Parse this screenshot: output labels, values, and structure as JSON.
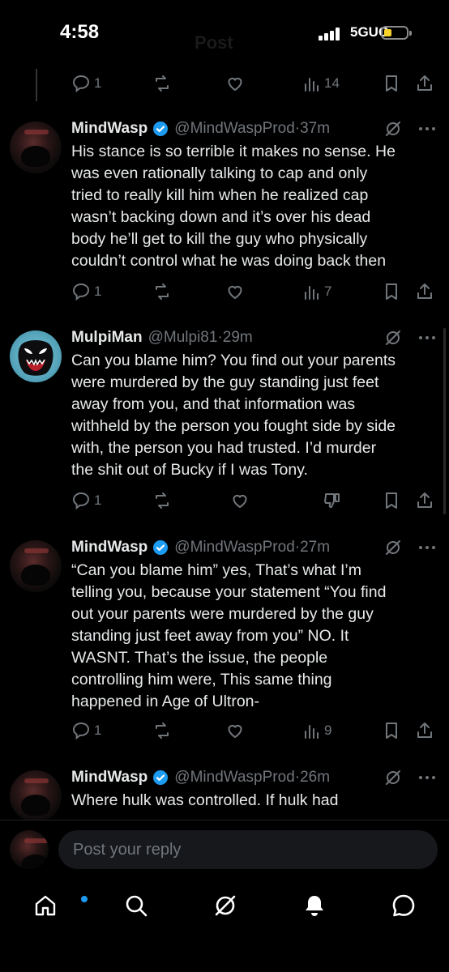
{
  "status_bar": {
    "time": "4:58",
    "network": "5GUC",
    "battery_level": 0.25,
    "header_title": "Post"
  },
  "top_actions": {
    "replies": "1",
    "views": "14"
  },
  "tweets": [
    {
      "name": "MindWasp",
      "verified": true,
      "handle": "@MindWaspProd",
      "time": "·37m",
      "lines": [
        "His stance is so terrible it makes no sense. He",
        "was even rationally talking to cap and only",
        "tried to really kill him when he realized cap",
        "wasn’t backing down and it’s over his dead",
        "body he’ll get to kill the guy who physically",
        "couldn’t control what he was doing back then"
      ],
      "replies": "1",
      "views": "7"
    },
    {
      "name": "MulpiMan",
      "verified": false,
      "handle": "@Mulpi81",
      "time": "·29m",
      "lines": [
        "Can you blame him? You find out your parents",
        "were murdered by the guy standing just feet",
        "away from you, and that information was",
        "withheld by the person you fought side by side",
        "with, the person you had trusted. I’d murder",
        "the shit out of Bucky if I was Tony."
      ],
      "replies": "1",
      "views": ""
    },
    {
      "name": "MindWasp",
      "verified": true,
      "handle": "@MindWaspProd",
      "time": "·27m",
      "lines": [
        "“Can you blame him” yes, That’s what I’m",
        "telling you, because your statement “You find",
        "out your parents were murdered by the guy",
        "standing just feet away from you” NO. It",
        "WASNT. That’s the issue, the people",
        "controlling him were, This same thing",
        "happened in Age of Ultron-"
      ],
      "replies": "1",
      "views": "9"
    },
    {
      "name": "MindWasp",
      "verified": true,
      "handle": "@MindWaspProd",
      "time": "·26m",
      "lines": [
        "Where hulk was controlled. If hulk had"
      ],
      "replies": "",
      "views": ""
    }
  ],
  "reply_bar": {
    "placeholder": "Post your reply"
  },
  "colors": {
    "accent": "#1d9bf0",
    "muted": "#71767b",
    "text": "#e7e9ea",
    "background": "#000000"
  },
  "tabbar": {
    "items": [
      "home-icon",
      "search-icon",
      "grok-icon",
      "notifications-icon",
      "messages-icon"
    ]
  }
}
